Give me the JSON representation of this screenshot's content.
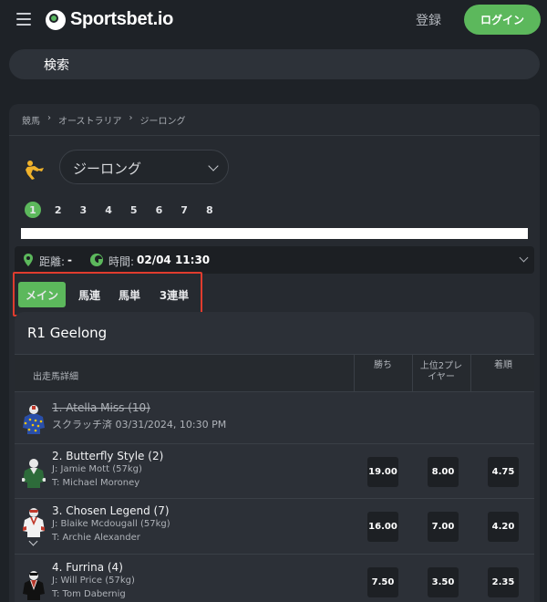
{
  "header": {
    "logo_text": "Sportsbet.io",
    "register_label": "登録",
    "login_label": "ログイン"
  },
  "search": {
    "label": "検索"
  },
  "breadcrumb": [
    "競馬",
    "オーストラリア",
    "ジーロング"
  ],
  "venue": {
    "selected": "ジーロング"
  },
  "races": [
    "1",
    "2",
    "3",
    "4",
    "5",
    "6",
    "7",
    "8"
  ],
  "active_race": "1",
  "info": {
    "distance_label": "距離:",
    "distance_value": "-",
    "time_label": "時間:",
    "time_value": "02/04 11:30"
  },
  "tabs": [
    "メイン",
    "馬連",
    "馬単",
    "3連単"
  ],
  "market": {
    "title": "R1 Geelong",
    "columns": {
      "detail": "出走馬詳細",
      "win": "勝ち",
      "top2_line1": "上位2プレ",
      "top2_line2": "イヤー",
      "order": "着順"
    }
  },
  "runners": [
    {
      "name": "1. Atella Miss (10)",
      "scratched": true,
      "status": "スクラッチ済 03/31/2024, 10:30 PM"
    },
    {
      "name": "2. Butterfly Style (2)",
      "jockey": "J: Jamie Mott (57kg)",
      "trainer": "T: Michael Moroney",
      "odds": [
        "19.00",
        "8.00",
        "4.75"
      ]
    },
    {
      "name": "3. Chosen Legend (7)",
      "jockey": "J: Blaike Mcdougall (57kg)",
      "trainer": "T: Archie Alexander",
      "odds": [
        "16.00",
        "7.00",
        "4.20"
      ]
    },
    {
      "name": "4. Furrina (4)",
      "jockey": "J: Will Price (57kg)",
      "trainer": "T: Tom Dabernig",
      "odds": [
        "7.50",
        "3.50",
        "2.35"
      ]
    }
  ],
  "colors": {
    "accent": "#5cb85c",
    "highlight_box": "#e03c2e"
  }
}
